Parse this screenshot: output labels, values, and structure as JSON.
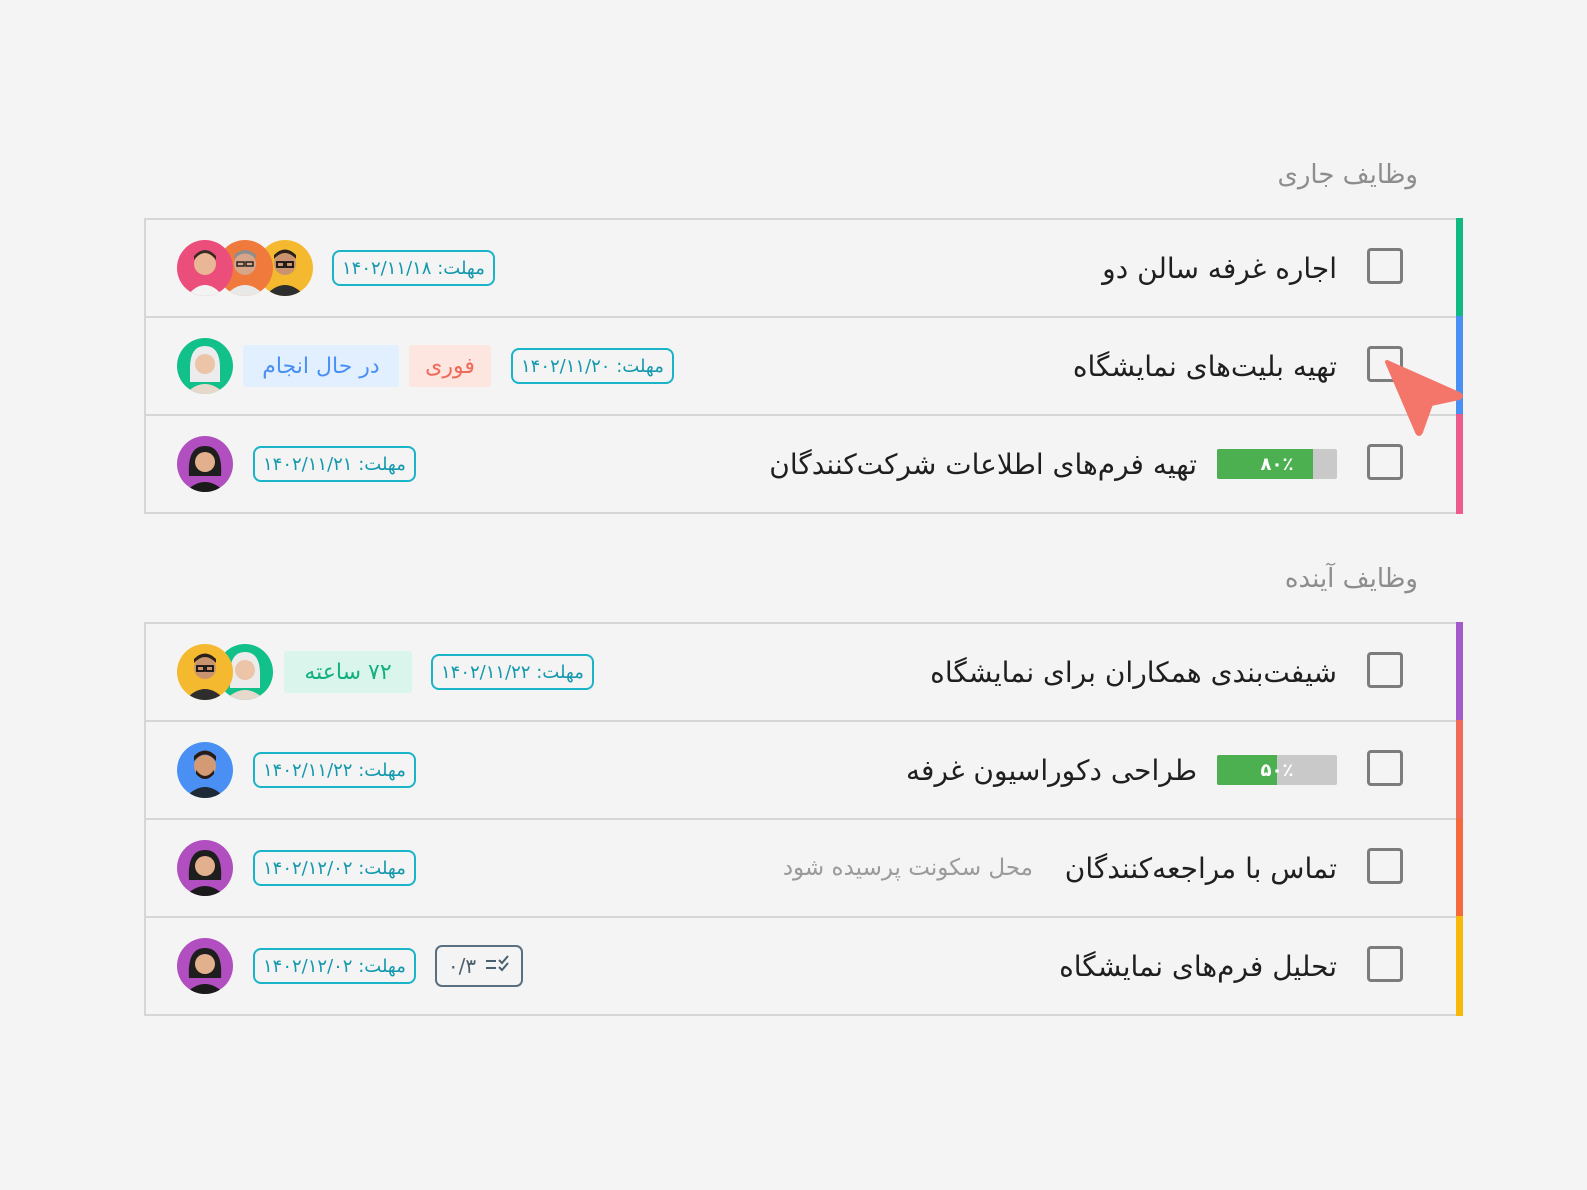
{
  "sections": [
    {
      "title": "وظایف جاری",
      "rows": [
        {
          "title": "اجاره غرفه سالن دو",
          "stripe": "#10b981",
          "deadline": "مهلت: ۱۴۰۲/۱۱/۱۸",
          "avatars": [
            "#ec4e7c",
            "#f07a3c",
            "#f4b92f"
          ]
        },
        {
          "title": "تهیه بلیت‌های نمایشگاه",
          "stripe": "#4a90f4",
          "deadline": "مهلت: ۱۴۰۲/۱۱/۲۰",
          "badge_urgent": "فوری",
          "badge_status": "در حال انجام",
          "avatars": [
            "#12c08a"
          ]
        },
        {
          "title": "تهیه فرم‌های اطلاعات شرکت‌کنندگان",
          "stripe": "#ec5b8a",
          "deadline": "مهلت: ۱۴۰۲/۱۱/۲۱",
          "progress": {
            "value": 0.8,
            "label": "۸۰٪"
          },
          "avatars": [
            "#b24fc0"
          ]
        }
      ]
    },
    {
      "title": "وظایف آینده",
      "rows": [
        {
          "title": "شیفت‌بندی همکاران برای نمایشگاه",
          "stripe": "#a25bc9",
          "deadline": "مهلت: ۱۴۰۲/۱۱/۲۲",
          "badge_time": "۷۲ ساعته",
          "avatars": [
            "#f4b92f",
            "#12c08a"
          ]
        },
        {
          "title": "طراحی دکوراسیون غرفه",
          "stripe": "#f06a5a",
          "deadline": "مهلت: ۱۴۰۲/۱۱/۲۲",
          "progress": {
            "value": 0.5,
            "label": "۵۰٪"
          },
          "avatars": [
            "#4a90f4"
          ]
        },
        {
          "title": "تماس با مراجعه‌کنندگان",
          "stripe": "#f46a3c",
          "subtitle": "محل سکونت پرسیده شود",
          "deadline": "مهلت: ۱۴۰۲/۱۲/۰۲",
          "avatars": [
            "#b24fc0"
          ]
        },
        {
          "title": "تحلیل فرم‌های نمایشگاه",
          "stripe": "#f6b90a",
          "deadline": "مهلت: ۱۴۰۲/۱۲/۰۲",
          "checklist": "۰/۳",
          "avatars": [
            "#b24fc0"
          ]
        }
      ]
    }
  ],
  "colors": {
    "deadline": "#1bb3c8",
    "urgent_bg": "#fde5e0",
    "urgent_fg": "#f06a5a",
    "status_bg": "#e2efff",
    "status_fg": "#4a90f4",
    "time_bg": "#d9f5ec",
    "time_fg": "#12b07e",
    "cursor": "#f4766a"
  }
}
